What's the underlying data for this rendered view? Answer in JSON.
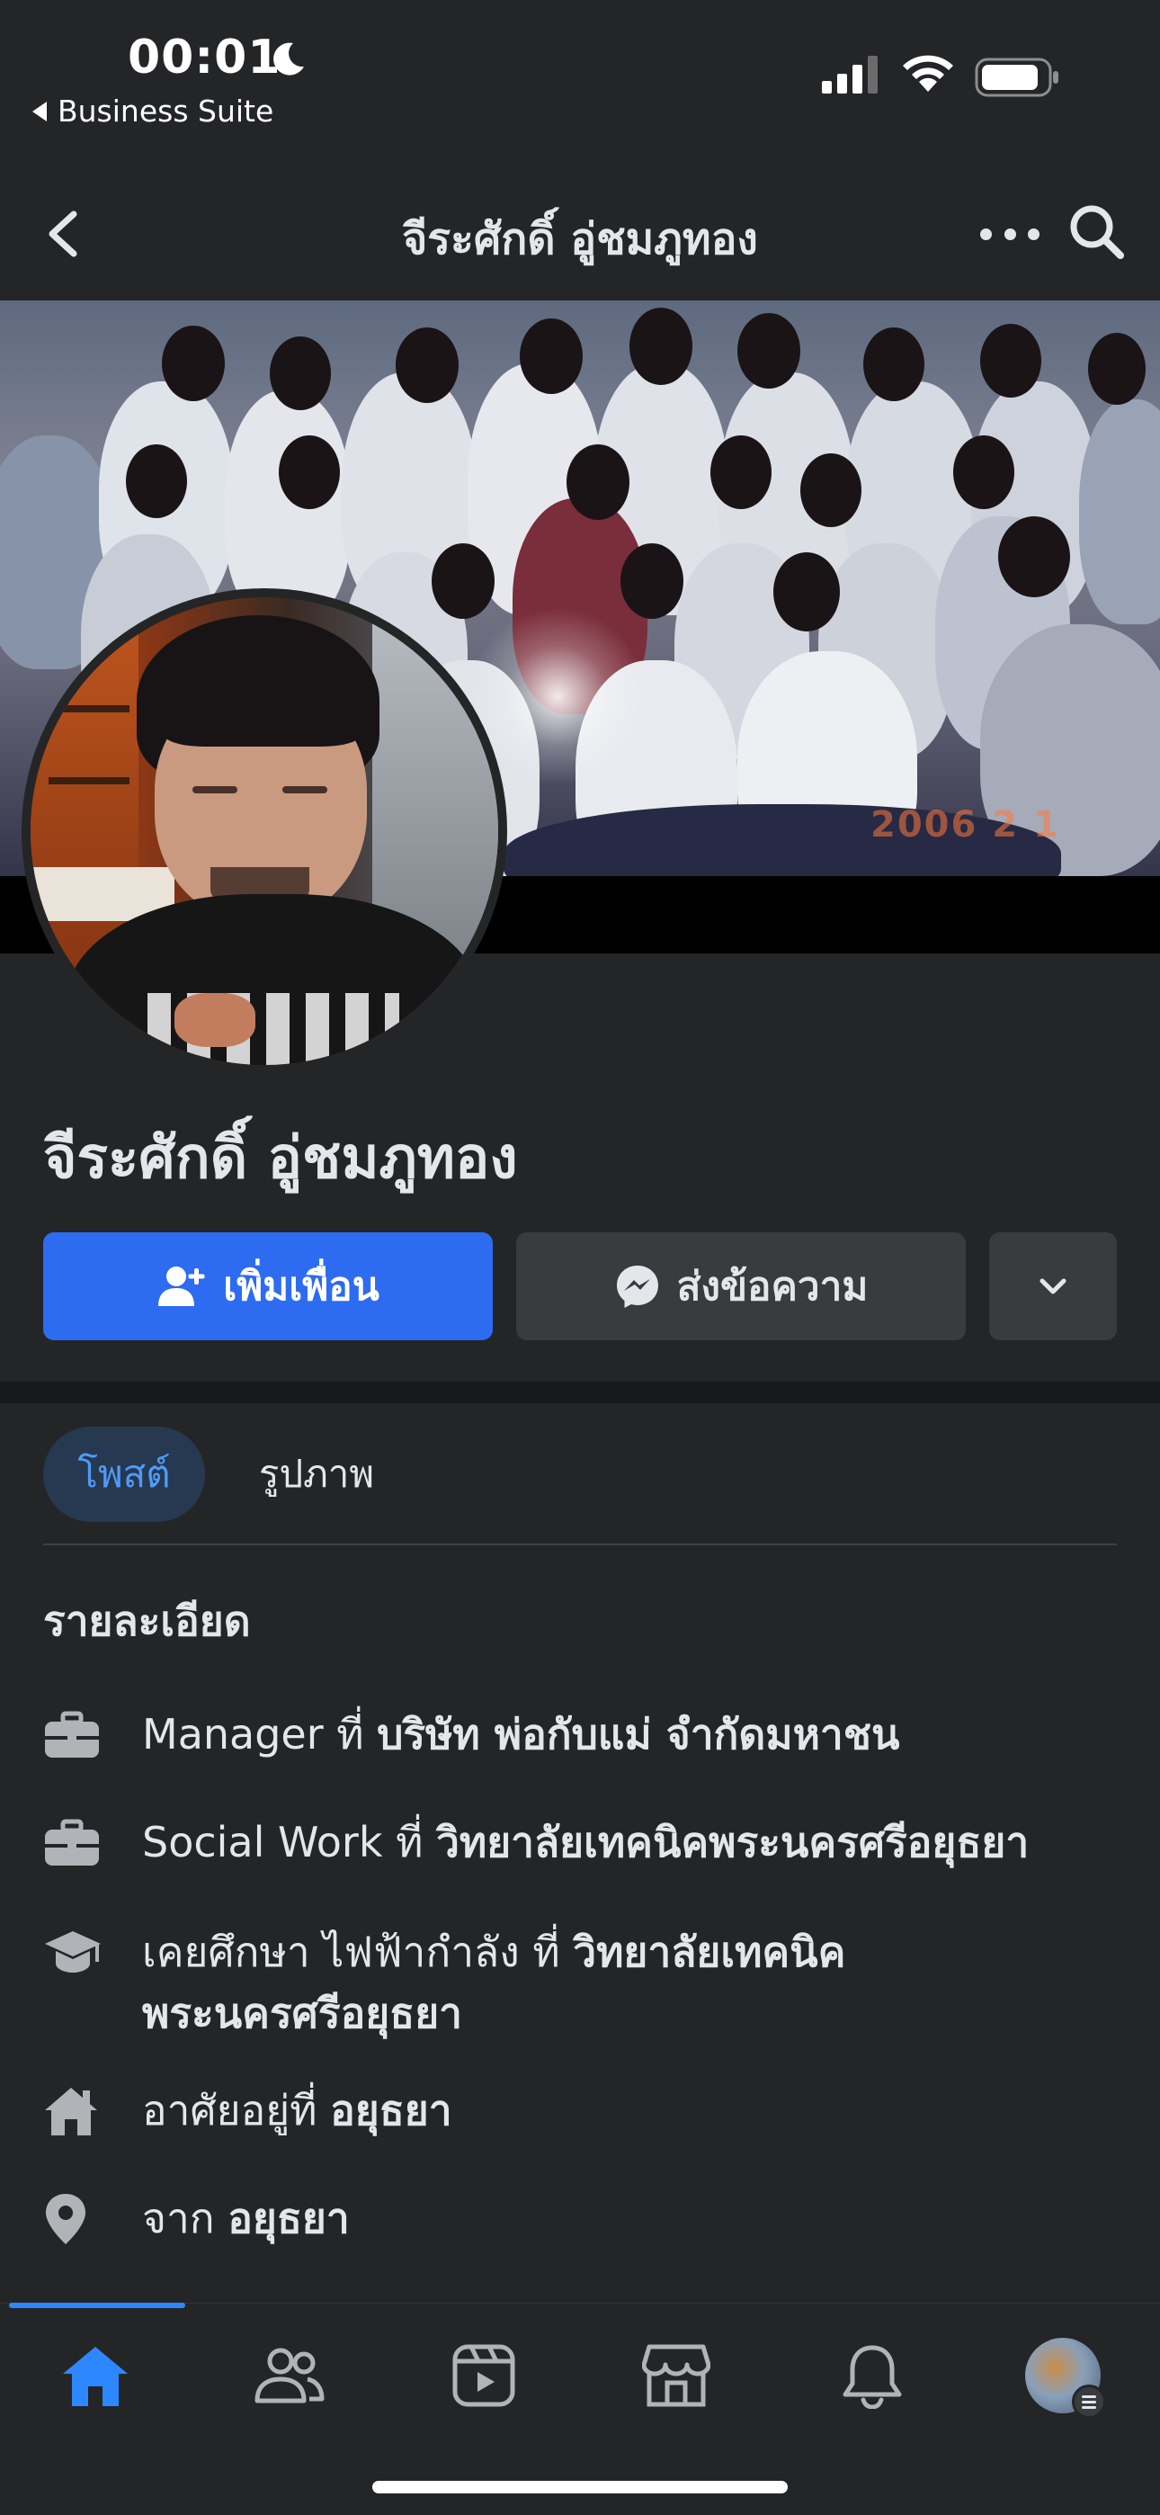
{
  "status_bar": {
    "time": "00:01",
    "back_app_label": "Business Suite",
    "icons": [
      "moon-icon",
      "cellular-signal-icon",
      "wifi-icon",
      "battery-icon"
    ]
  },
  "header": {
    "title": "จีระศักดิ์ อู่ชมภูทอง",
    "icons": [
      "back-chevron-icon",
      "more-dots-icon",
      "search-icon"
    ]
  },
  "cover": {
    "date_stamp": "2006  2  1"
  },
  "profile": {
    "name": "จีระศักดิ์ อู่ชมภูทอง",
    "add_friend_label": "เพิ่มเพื่อน",
    "message_label": "ส่งข้อความ"
  },
  "tabs": [
    {
      "label": "โพสต์",
      "active": true
    },
    {
      "label": "รูปภาพ",
      "active": false
    }
  ],
  "details": {
    "title": "รายละเอียด",
    "items": [
      {
        "icon": "briefcase-icon",
        "prefix": "Manager ที่ ",
        "bold": "บริษัท พ่อกับแม่ จำกัดมหาชน"
      },
      {
        "icon": "briefcase-icon",
        "prefix": "Social Work ที่ ",
        "bold": "วิทยาลัยเทคนิคพระนครศรีอยุธยา"
      },
      {
        "icon": "graduation-cap-icon",
        "prefix": "เคยศึกษา ไฟฟ้ากำลัง ที่ ",
        "bold": "วิทยาลัยเทคนิค พระนครศรีอยุธยา"
      },
      {
        "icon": "home-icon",
        "prefix": "อาศัยอยู่ที่ ",
        "bold": "อยุธยา"
      },
      {
        "icon": "location-pin-icon",
        "prefix": "จาก ",
        "bold": "อยุธยา"
      }
    ]
  },
  "bottom_nav": {
    "items": [
      "home",
      "friends",
      "watch",
      "marketplace",
      "notifications",
      "profile-menu"
    ],
    "active": "home",
    "accent": "#2d88ff"
  },
  "colors": {
    "background": "#242526",
    "primary_button": "#2d6cf0",
    "secondary_button": "#3a3b3c",
    "active_tab_bg": "#263951",
    "active_tab_text": "#4f9bf7"
  }
}
